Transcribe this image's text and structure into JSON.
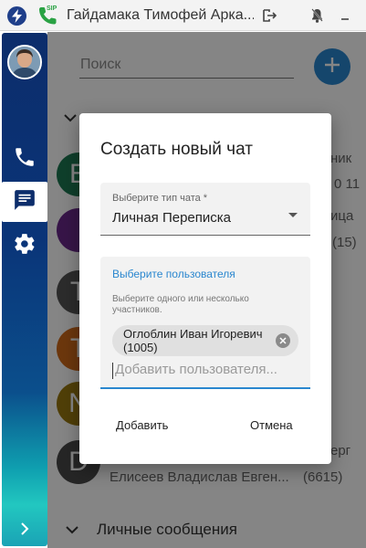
{
  "titlebar": {
    "title": "Гайдамака Тимофей Арка...",
    "sip_label": "SIP",
    "icons": [
      "app-logo-icon",
      "sip-phone-icon",
      "logout-icon",
      "bell-icon",
      "minimize-icon"
    ],
    "colors": {
      "logo": "#1f3f8a",
      "sip": "#2aa244"
    }
  },
  "rail": {
    "items": [
      {
        "name": "phone-icon",
        "active": false
      },
      {
        "name": "chat-icon",
        "active": true
      },
      {
        "name": "settings-icon",
        "active": false
      }
    ],
    "expand_icon": "chevron-right-icon"
  },
  "main": {
    "search_placeholder": "Поиск",
    "fab_icon": "plus-icon",
    "chats": [
      {
        "letter": "E",
        "color": "#1e7a54"
      },
      {
        "letter": "",
        "color": "#6a2a8a"
      },
      {
        "letter": "T",
        "color": "#555555"
      },
      {
        "letter": "T",
        "color": "#d06a1a"
      },
      {
        "letter": "N",
        "color": "#9a7a10"
      },
      {
        "letter": "D",
        "color": "#4a4a4a"
      }
    ],
    "peek": [
      "ник",
      "0 11",
      "ица",
      "(15)",
      "ерг"
    ],
    "last_row": "Елисеев Владислав Евген...",
    "last_row_ext": "(6615)",
    "section": "Личные сообщения",
    "accent": "#2a87cf"
  },
  "dialog": {
    "title": "Создать новый чат",
    "chat_type": {
      "label": "Выберите тип чата *",
      "value": "Личная Переписка"
    },
    "users": {
      "label": "Выберите пользователя",
      "hint": "Выберите одного или несколько участников.",
      "chips": [
        {
          "text": "Оглоблин Иван Игоревич (1005)"
        }
      ],
      "input_placeholder": "Добавить пользователя..."
    },
    "buttons": {
      "add": "Добавить",
      "cancel": "Отмена"
    }
  }
}
